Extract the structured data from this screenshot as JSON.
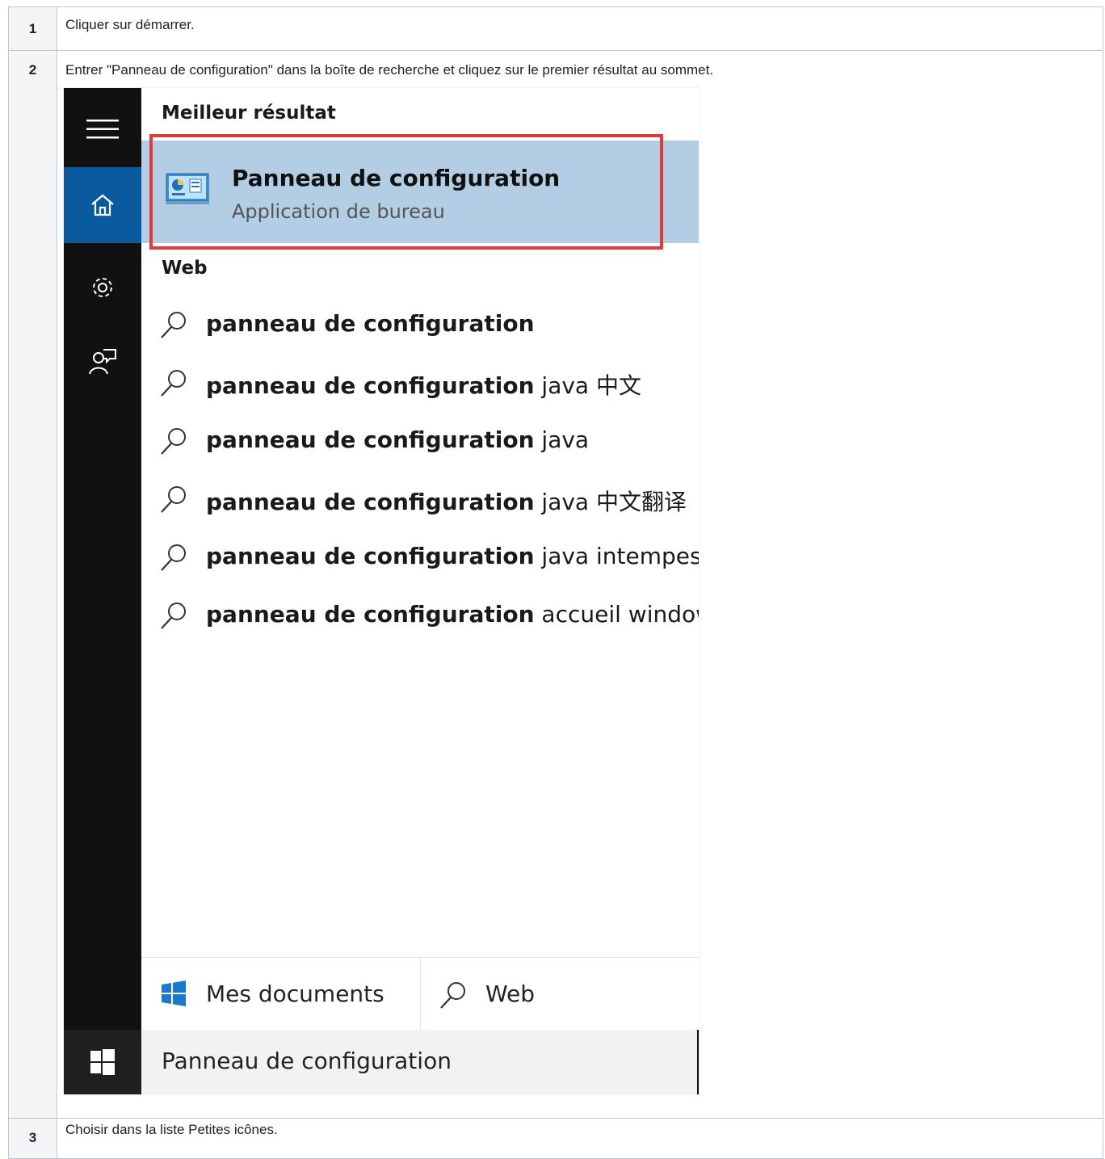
{
  "steps": [
    {
      "num": "1",
      "text": "Cliquer sur démarrer."
    },
    {
      "num": "2",
      "text": "Entrer \"Panneau de configuration\" dans la boîte de recherche et cliquez sur le premier résultat au sommet."
    },
    {
      "num": "3",
      "text": "Choisir dans la liste  Petites icônes."
    }
  ],
  "search_panel": {
    "best_match_label": "Meilleur résultat",
    "best_match": {
      "title": "Panneau de configuration",
      "subtitle": "Application de bureau",
      "icon": "control-panel-icon"
    },
    "web_label": "Web",
    "web_results": [
      {
        "bold": "panneau de configuration",
        "rest": ""
      },
      {
        "bold": "panneau de configuration",
        "rest": " java 中文"
      },
      {
        "bold": "panneau de configuration",
        "rest": " java"
      },
      {
        "bold": "panneau de configuration",
        "rest": " java 中文翻译"
      },
      {
        "bold": "panneau de configuration",
        "rest": " java intempestif"
      },
      {
        "bold": "panneau de configuration",
        "rest": " accueil windows"
      }
    ],
    "filters": {
      "my_documents": "Mes documents",
      "web": "Web"
    },
    "search_query": "Panneau de configuration",
    "rail_icons": [
      "hamburger-icon",
      "home-icon",
      "gear-icon",
      "feedback-icon",
      "windows-start-icon"
    ],
    "colors": {
      "selected_bg": "#b3cde4",
      "highlight_border": "#e0393e",
      "rail_bg": "#111111",
      "home_active": "#0a5a9f"
    }
  }
}
